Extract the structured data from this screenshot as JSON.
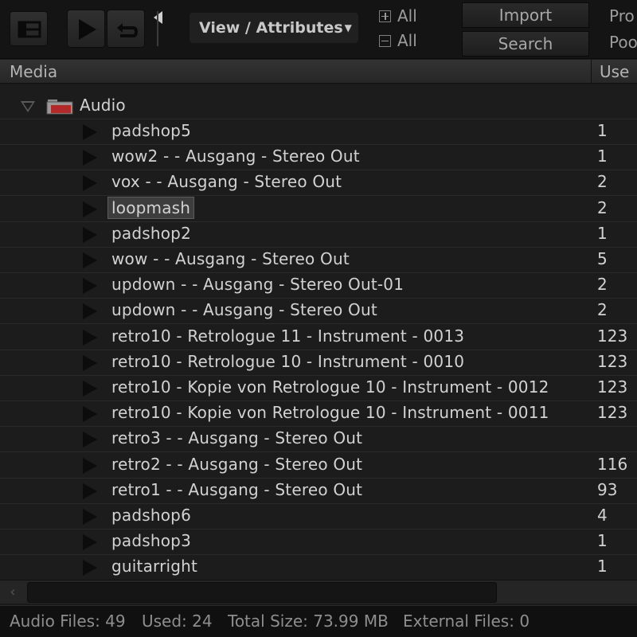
{
  "toolbar": {
    "view_attributes_label": "View / Attributes",
    "expand_all_label": "All",
    "collapse_all_label": "All",
    "import_label": "Import",
    "search_label": "Search",
    "right_label_top": "Pro",
    "right_label_bottom": "Poo"
  },
  "columns": {
    "media": "Media",
    "use": "Use"
  },
  "root": {
    "label": "Audio"
  },
  "items": [
    {
      "name": "padshop5",
      "use": "1"
    },
    {
      "name": "wow2 -  - Ausgang - Stereo Out",
      "use": "1"
    },
    {
      "name": "vox -  - Ausgang - Stereo Out",
      "use": "2"
    },
    {
      "name": "loopmash",
      "use": "2"
    },
    {
      "name": "padshop2",
      "use": "1"
    },
    {
      "name": "wow -  - Ausgang - Stereo Out",
      "use": "5"
    },
    {
      "name": "updown -  - Ausgang - Stereo Out-01",
      "use": "2"
    },
    {
      "name": "updown -  - Ausgang - Stereo Out",
      "use": "2"
    },
    {
      "name": "retro10 - Retrologue 11 - Instrument - 0013",
      "use": "123"
    },
    {
      "name": "retro10 - Retrologue 10 - Instrument - 0010",
      "use": "123"
    },
    {
      "name": "retro10 - Kopie von Retrologue 10 - Instrument - 0012",
      "use": "123"
    },
    {
      "name": "retro10 - Kopie von Retrologue 10 - Instrument - 0011",
      "use": "123"
    },
    {
      "name": "retro3 -  - Ausgang - Stereo Out",
      "use": ""
    },
    {
      "name": "retro2 -  - Ausgang - Stereo Out",
      "use": "116"
    },
    {
      "name": "retro1 -  - Ausgang - Stereo Out",
      "use": "93"
    },
    {
      "name": "padshop6",
      "use": "4"
    },
    {
      "name": "padshop3",
      "use": "1"
    },
    {
      "name": "guitarright",
      "use": "1"
    }
  ],
  "status": {
    "audio_files": "Audio Files: 49",
    "used": "Used: 24",
    "total_size": "Total Size: 73.99 MB",
    "external_files": "External Files: 0"
  },
  "colors": {
    "background": "#1c1c1c",
    "text": "#d2d2d2",
    "selection": "#3d3d3d",
    "folder_red": "#b42828"
  }
}
